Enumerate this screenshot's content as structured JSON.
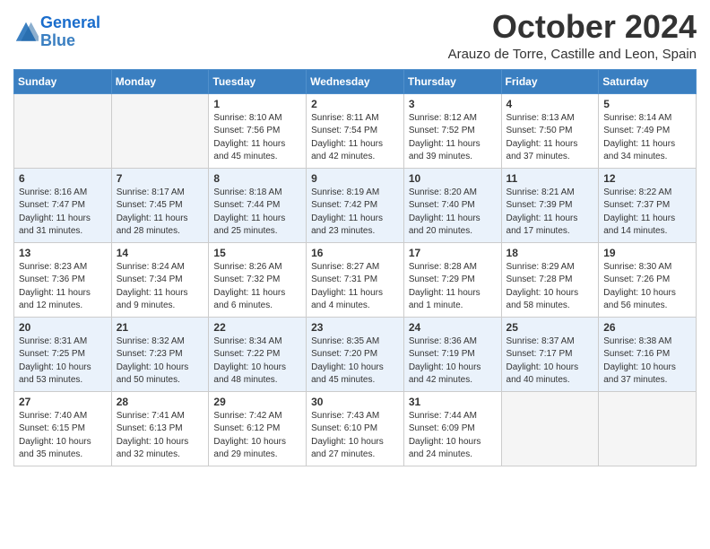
{
  "logo": {
    "line1": "General",
    "line2": "Blue"
  },
  "title": "October 2024",
  "subtitle": "Arauzo de Torre, Castille and Leon, Spain",
  "headers": [
    "Sunday",
    "Monday",
    "Tuesday",
    "Wednesday",
    "Thursday",
    "Friday",
    "Saturday"
  ],
  "weeks": [
    [
      {
        "day": "",
        "info": ""
      },
      {
        "day": "",
        "info": ""
      },
      {
        "day": "1",
        "info": "Sunrise: 8:10 AM\nSunset: 7:56 PM\nDaylight: 11 hours and 45 minutes."
      },
      {
        "day": "2",
        "info": "Sunrise: 8:11 AM\nSunset: 7:54 PM\nDaylight: 11 hours and 42 minutes."
      },
      {
        "day": "3",
        "info": "Sunrise: 8:12 AM\nSunset: 7:52 PM\nDaylight: 11 hours and 39 minutes."
      },
      {
        "day": "4",
        "info": "Sunrise: 8:13 AM\nSunset: 7:50 PM\nDaylight: 11 hours and 37 minutes."
      },
      {
        "day": "5",
        "info": "Sunrise: 8:14 AM\nSunset: 7:49 PM\nDaylight: 11 hours and 34 minutes."
      }
    ],
    [
      {
        "day": "6",
        "info": "Sunrise: 8:16 AM\nSunset: 7:47 PM\nDaylight: 11 hours and 31 minutes."
      },
      {
        "day": "7",
        "info": "Sunrise: 8:17 AM\nSunset: 7:45 PM\nDaylight: 11 hours and 28 minutes."
      },
      {
        "day": "8",
        "info": "Sunrise: 8:18 AM\nSunset: 7:44 PM\nDaylight: 11 hours and 25 minutes."
      },
      {
        "day": "9",
        "info": "Sunrise: 8:19 AM\nSunset: 7:42 PM\nDaylight: 11 hours and 23 minutes."
      },
      {
        "day": "10",
        "info": "Sunrise: 8:20 AM\nSunset: 7:40 PM\nDaylight: 11 hours and 20 minutes."
      },
      {
        "day": "11",
        "info": "Sunrise: 8:21 AM\nSunset: 7:39 PM\nDaylight: 11 hours and 17 minutes."
      },
      {
        "day": "12",
        "info": "Sunrise: 8:22 AM\nSunset: 7:37 PM\nDaylight: 11 hours and 14 minutes."
      }
    ],
    [
      {
        "day": "13",
        "info": "Sunrise: 8:23 AM\nSunset: 7:36 PM\nDaylight: 11 hours and 12 minutes."
      },
      {
        "day": "14",
        "info": "Sunrise: 8:24 AM\nSunset: 7:34 PM\nDaylight: 11 hours and 9 minutes."
      },
      {
        "day": "15",
        "info": "Sunrise: 8:26 AM\nSunset: 7:32 PM\nDaylight: 11 hours and 6 minutes."
      },
      {
        "day": "16",
        "info": "Sunrise: 8:27 AM\nSunset: 7:31 PM\nDaylight: 11 hours and 4 minutes."
      },
      {
        "day": "17",
        "info": "Sunrise: 8:28 AM\nSunset: 7:29 PM\nDaylight: 11 hours and 1 minute."
      },
      {
        "day": "18",
        "info": "Sunrise: 8:29 AM\nSunset: 7:28 PM\nDaylight: 10 hours and 58 minutes."
      },
      {
        "day": "19",
        "info": "Sunrise: 8:30 AM\nSunset: 7:26 PM\nDaylight: 10 hours and 56 minutes."
      }
    ],
    [
      {
        "day": "20",
        "info": "Sunrise: 8:31 AM\nSunset: 7:25 PM\nDaylight: 10 hours and 53 minutes."
      },
      {
        "day": "21",
        "info": "Sunrise: 8:32 AM\nSunset: 7:23 PM\nDaylight: 10 hours and 50 minutes."
      },
      {
        "day": "22",
        "info": "Sunrise: 8:34 AM\nSunset: 7:22 PM\nDaylight: 10 hours and 48 minutes."
      },
      {
        "day": "23",
        "info": "Sunrise: 8:35 AM\nSunset: 7:20 PM\nDaylight: 10 hours and 45 minutes."
      },
      {
        "day": "24",
        "info": "Sunrise: 8:36 AM\nSunset: 7:19 PM\nDaylight: 10 hours and 42 minutes."
      },
      {
        "day": "25",
        "info": "Sunrise: 8:37 AM\nSunset: 7:17 PM\nDaylight: 10 hours and 40 minutes."
      },
      {
        "day": "26",
        "info": "Sunrise: 8:38 AM\nSunset: 7:16 PM\nDaylight: 10 hours and 37 minutes."
      }
    ],
    [
      {
        "day": "27",
        "info": "Sunrise: 7:40 AM\nSunset: 6:15 PM\nDaylight: 10 hours and 35 minutes."
      },
      {
        "day": "28",
        "info": "Sunrise: 7:41 AM\nSunset: 6:13 PM\nDaylight: 10 hours and 32 minutes."
      },
      {
        "day": "29",
        "info": "Sunrise: 7:42 AM\nSunset: 6:12 PM\nDaylight: 10 hours and 29 minutes."
      },
      {
        "day": "30",
        "info": "Sunrise: 7:43 AM\nSunset: 6:10 PM\nDaylight: 10 hours and 27 minutes."
      },
      {
        "day": "31",
        "info": "Sunrise: 7:44 AM\nSunset: 6:09 PM\nDaylight: 10 hours and 24 minutes."
      },
      {
        "day": "",
        "info": ""
      },
      {
        "day": "",
        "info": ""
      }
    ]
  ]
}
